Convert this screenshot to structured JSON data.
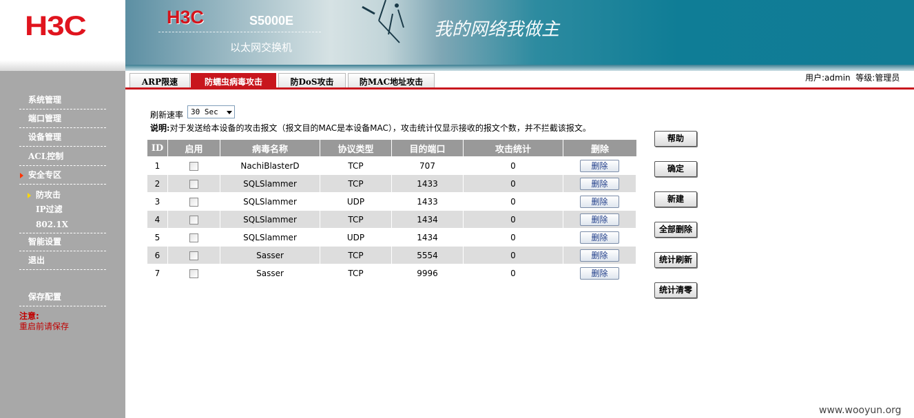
{
  "header": {
    "logo": "H3C",
    "brand": "H3C",
    "model": "S5000E",
    "subtitle": "以太网交换机",
    "slogan": "我的网络我做主"
  },
  "tabs": [
    {
      "label": "ARP限速",
      "active": false
    },
    {
      "label": "防蠕虫病毒攻击",
      "active": true
    },
    {
      "label": "防DoS攻击",
      "active": false
    },
    {
      "label": "防MAC地址攻击",
      "active": false
    }
  ],
  "user_info": "用户:admin  等级:管理员",
  "sidebar": {
    "items": [
      {
        "label": "系统管理"
      },
      {
        "label": "端口管理"
      },
      {
        "label": "设备管理"
      },
      {
        "label": "ACL控制"
      },
      {
        "label": "安全专区"
      },
      {
        "label": "防攻击"
      },
      {
        "label": "IP过滤"
      },
      {
        "label": "802.1X"
      },
      {
        "label": "智能设置"
      },
      {
        "label": "退出"
      },
      {
        "label": "保存配置"
      }
    ],
    "note_title": "注意:",
    "note_text": "重启前请保存",
    "arrow_color": "#ff3300",
    "sub_arrow_color": "#ffd700"
  },
  "content": {
    "refresh_label": "刷新速率",
    "refresh_value": "30 Sec",
    "desc_label": "说明:",
    "desc_text": "对于发送给本设备的攻击报文（报文目的MAC是本设备MAC），攻击统计仅显示接收的报文个数，并不拦截该报文。"
  },
  "table": {
    "headers": [
      "ID",
      "启用",
      "病毒名称",
      "协议类型",
      "目的端口",
      "攻击统计",
      "删除"
    ],
    "delete_label": "删除",
    "rows": [
      {
        "id": "1",
        "name": "NachiBlasterD",
        "protocol": "TCP",
        "port": "707",
        "count": "0"
      },
      {
        "id": "2",
        "name": "SQLSlammer",
        "protocol": "TCP",
        "port": "1433",
        "count": "0"
      },
      {
        "id": "3",
        "name": "SQLSlammer",
        "protocol": "UDP",
        "port": "1433",
        "count": "0"
      },
      {
        "id": "4",
        "name": "SQLSlammer",
        "protocol": "TCP",
        "port": "1434",
        "count": "0"
      },
      {
        "id": "5",
        "name": "SQLSlammer",
        "protocol": "UDP",
        "port": "1434",
        "count": "0"
      },
      {
        "id": "6",
        "name": "Sasser",
        "protocol": "TCP",
        "port": "5554",
        "count": "0"
      },
      {
        "id": "7",
        "name": "Sasser",
        "protocol": "TCP",
        "port": "9996",
        "count": "0"
      }
    ]
  },
  "buttons": {
    "help": "帮助",
    "confirm": "确定",
    "new": "新建",
    "delete_all": "全部删除",
    "stat_refresh": "统计刷新",
    "stat_clear": "统计清零"
  },
  "watermark": "www.wooyun.org",
  "colors": {
    "accent": "#c8161d",
    "sidebar": "#a8a8a8",
    "table_header": "#999999",
    "row_alt": "#dddddd"
  }
}
